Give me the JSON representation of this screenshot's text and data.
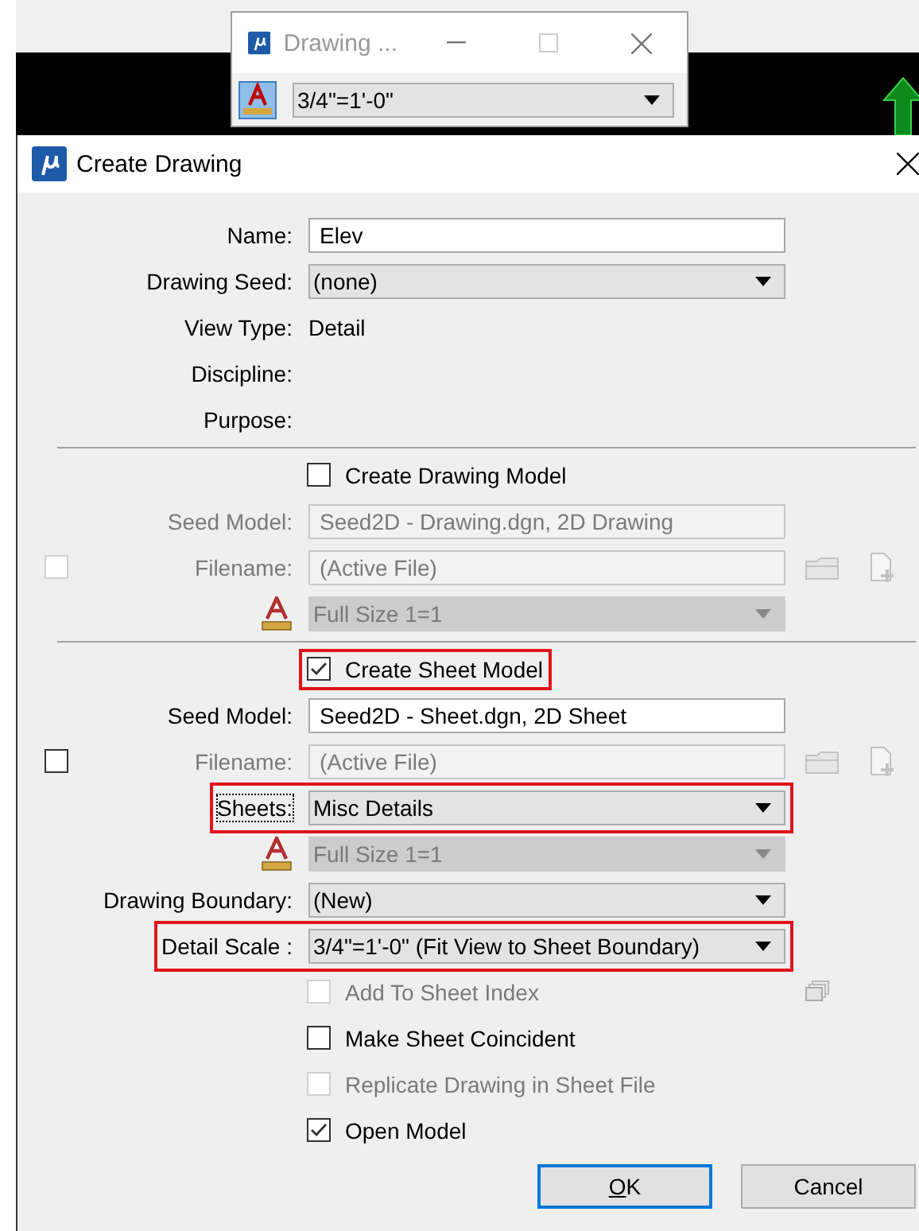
{
  "mini_window": {
    "title": "Drawing ...",
    "scale": "3/4\"=1'-0\""
  },
  "dialog": {
    "title": "Create Drawing",
    "rows": [
      {
        "kind": "input",
        "label": "Name:",
        "value": "Elev",
        "disabled": false
      },
      {
        "kind": "dropdown",
        "label": "Drawing Seed:",
        "value": "(none)",
        "disabled": false
      },
      {
        "kind": "static",
        "label": "View Type:",
        "value": "Detail"
      },
      {
        "kind": "static",
        "label": "Discipline:"
      },
      {
        "kind": "static",
        "label": "Purpose:"
      },
      {
        "kind": "separator"
      },
      {
        "kind": "checkbox",
        "label": "Create Drawing Model",
        "checked": false,
        "disabled": false
      },
      {
        "kind": "input",
        "label": "Seed Model:",
        "value": "Seed2D - Drawing.dgn, 2D Drawing",
        "disabled": true
      },
      {
        "kind": "input",
        "label": "Filename:",
        "value": "(Active File)",
        "disabled": true,
        "left_checkbox": {
          "checked": false,
          "disabled": true
        },
        "file_buttons": true
      },
      {
        "kind": "dropdown",
        "scale_icon": true,
        "value": "Full Size 1=1",
        "disabled": true
      },
      {
        "kind": "separator"
      },
      {
        "kind": "checkbox",
        "label": "Create Sheet Model",
        "checked": true,
        "disabled": false,
        "highlighted": true
      },
      {
        "kind": "input",
        "label": "Seed Model:",
        "value": "Seed2D - Sheet.dgn, 2D Sheet",
        "disabled": false
      },
      {
        "kind": "input",
        "label": "Filename:",
        "value": "(Active File)",
        "disabled": true,
        "left_checkbox": {
          "checked": false,
          "disabled": false
        },
        "file_buttons": true
      },
      {
        "kind": "dropdown",
        "label": "Sheets:",
        "value": "Misc Details",
        "disabled": false,
        "highlighted": true,
        "focused": true
      },
      {
        "kind": "dropdown",
        "scale_icon": true,
        "value": "Full Size 1=1",
        "disabled": true
      },
      {
        "kind": "dropdown",
        "label": "Drawing Boundary:",
        "value": "(New)",
        "disabled": false
      },
      {
        "kind": "dropdown",
        "label": "Detail Scale :",
        "value": "3/4\"=1'-0\" (Fit View to Sheet Boundary)",
        "disabled": false,
        "highlighted": true
      },
      {
        "kind": "checkbox",
        "label": "Add To Sheet Index",
        "checked": false,
        "disabled": true,
        "index_button": true
      },
      {
        "kind": "checkbox",
        "label": "Make Sheet Coincident",
        "checked": false,
        "disabled": false
      },
      {
        "kind": "checkbox",
        "label": "Replicate Drawing in Sheet File",
        "checked": false,
        "disabled": true
      },
      {
        "kind": "checkbox",
        "label": "Open Model",
        "checked": true,
        "disabled": false
      }
    ],
    "buttons": [
      {
        "label": "OK",
        "default": true,
        "mnemonic": true
      },
      {
        "label": "Cancel",
        "default": false,
        "mnemonic": false
      }
    ]
  }
}
